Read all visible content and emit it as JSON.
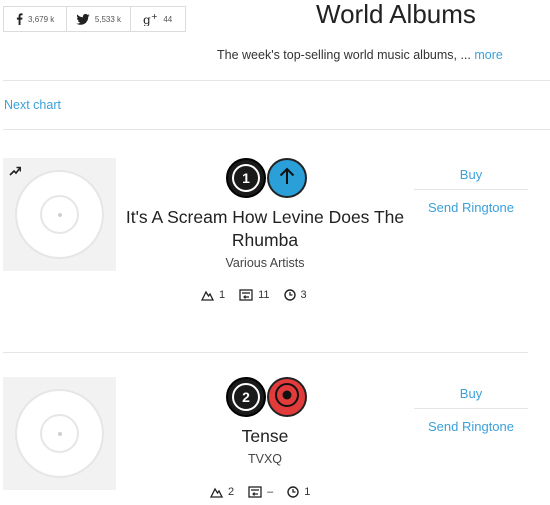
{
  "share": {
    "facebook_count": "3,679 k",
    "twitter_count": "5,533 k",
    "gplus_count": "44"
  },
  "header": {
    "title": "World Albums",
    "description": "The week's top-selling world music albums, ...",
    "more_label": "more"
  },
  "nav": {
    "next_chart": "Next chart"
  },
  "entries": [
    {
      "rank": "1",
      "movement": "up",
      "title": "It's A Scream How Levine Does The Rhumba",
      "artist": "Various Artists",
      "peak": "1",
      "last_week": "11",
      "weeks": "3",
      "buy_label": "Buy",
      "ringtone_label": "Send Ringtone"
    },
    {
      "rank": "2",
      "movement": "new",
      "title": "Tense",
      "artist": "TVXQ",
      "peak": "2",
      "last_week": "–",
      "weeks": "1",
      "buy_label": "Buy",
      "ringtone_label": "Send Ringtone"
    }
  ],
  "colors": {
    "link": "#3ba1da",
    "move_up": "#2a9fd8",
    "move_new": "#e23b3b"
  }
}
